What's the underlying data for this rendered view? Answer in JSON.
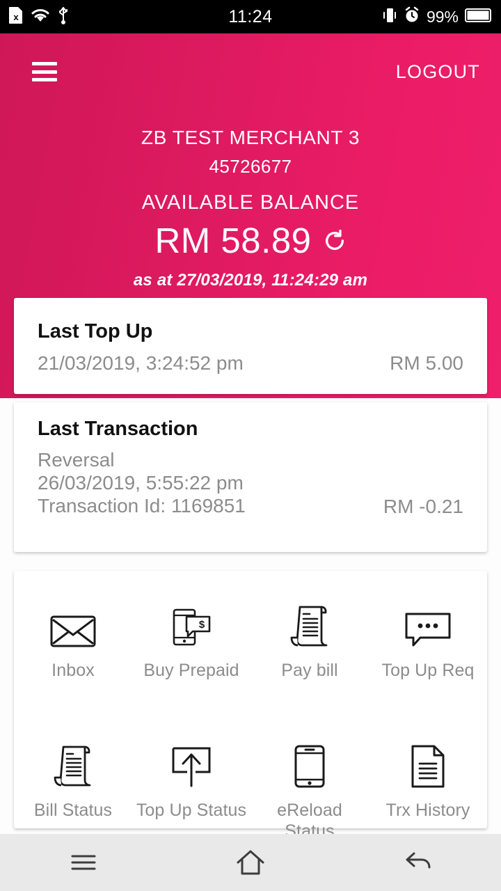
{
  "status_bar": {
    "time": "11:24",
    "battery_percent": "99%",
    "icons": [
      "sim-card-error-icon",
      "wifi-icon",
      "usb-icon",
      "vibrate-icon",
      "alarm-clock-icon",
      "battery-icon"
    ]
  },
  "header": {
    "menu_icon": "hamburger-menu-icon",
    "logout_label": "LOGOUT",
    "merchant_name": "ZB TEST MERCHANT 3",
    "account_number": "45726677",
    "balance_label": "AVAILABLE BALANCE",
    "balance_amount": "RM 58.89",
    "refresh_icon": "refresh-icon",
    "as_at": "as at 27/03/2019, 11:24:29 am",
    "accent_color": "#e01b62"
  },
  "last_top_up": {
    "title": "Last Top Up",
    "datetime": "21/03/2019, 3:24:52 pm",
    "amount": "RM 5.00"
  },
  "last_transaction": {
    "title": "Last Transaction",
    "type": "Reversal",
    "datetime": "26/03/2019, 5:55:22 pm",
    "transaction_id": "Transaction Id: 1169851",
    "amount": "RM -0.21"
  },
  "menu_grid": [
    {
      "label": "Inbox",
      "icon": "envelope-icon"
    },
    {
      "label": "Buy Prepaid",
      "icon": "phone-dollar-bubble-icon"
    },
    {
      "label": "Pay bill",
      "icon": "receipt-scroll-icon"
    },
    {
      "label": "Top Up Req",
      "icon": "chat-bubble-dots-icon"
    },
    {
      "label": "Bill Status",
      "icon": "receipt-scroll-icon"
    },
    {
      "label": "Top Up\nStatus",
      "icon": "upload-box-arrow-icon"
    },
    {
      "label": "eReload\nStatus",
      "icon": "mobile-phone-icon"
    },
    {
      "label": "Trx History",
      "icon": "document-lines-icon"
    }
  ],
  "menu_grid_labels": {
    "inbox": "Inbox",
    "buy_prepaid": "Buy Prepaid",
    "pay_bill": "Pay bill",
    "top_up_req": "Top Up Req",
    "bill_status": "Bill Status",
    "top_up_status": "Top Up Status",
    "ereload_status": "eReload Status",
    "trx_history": "Trx History"
  },
  "nav_bar": {
    "recents_icon": "recents-icon",
    "home_icon": "home-icon",
    "back_icon": "back-arrow-icon"
  }
}
